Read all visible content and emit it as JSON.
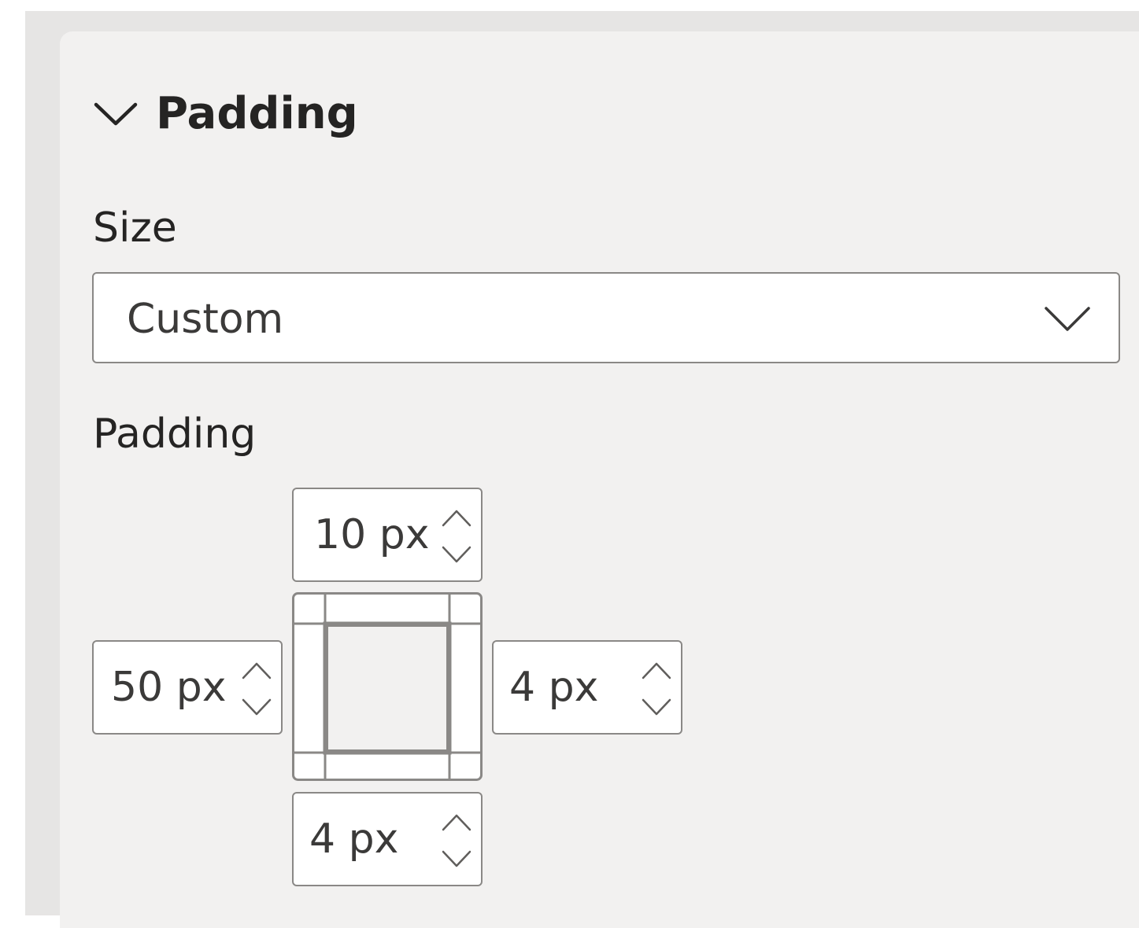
{
  "section": {
    "title": "Padding",
    "expanded": true
  },
  "size": {
    "label": "Size",
    "value": "Custom"
  },
  "padding": {
    "label": "Padding",
    "top": "10 px",
    "left": "50 px",
    "right": "4 px",
    "bottom": "4 px"
  },
  "icons": {
    "section_toggle": "chevron-down-icon",
    "dropdown_toggle": "chevron-down-icon",
    "spin_up": "chevron-up-icon",
    "spin_down": "chevron-down-icon",
    "diagram": "padding-box-icon"
  },
  "colors": {
    "panel_bg": "#f2f1f0",
    "border": "#8a8886",
    "text": "#252423"
  }
}
